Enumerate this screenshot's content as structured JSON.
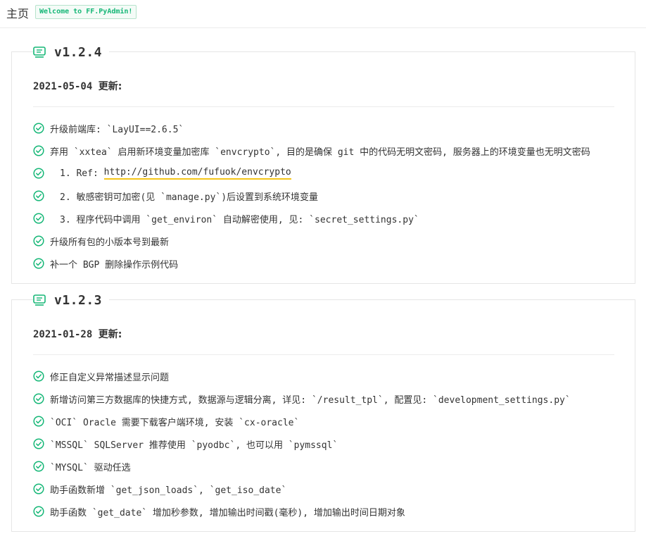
{
  "header": {
    "home_label": "主页",
    "welcome_text": "Welcome to FF.PyAdmin!"
  },
  "colors": {
    "accent": "#16b777",
    "link_underline": "#f5c518",
    "border": "#e6e6e6"
  },
  "icons": {
    "title": "note-icon",
    "bullet": "check-circle-icon"
  },
  "releases": [
    {
      "version": "v1.2.4",
      "date": "2021-05-04",
      "update_label": "更新:",
      "items": [
        {
          "text": "升级前端库: `LayUI==2.6.5`"
        },
        {
          "text": "弃用 `xxtea` 启用新环境变量加密库 `envcrypto`, 目的是确保 git 中的代码无明文密码, 服务器上的环境变量也无明文密码"
        },
        {
          "prefix": "1. Ref: ",
          "link": "http://github.com/fufuok/envcrypto"
        },
        {
          "text": "2. 敏感密钥可加密(见 `manage.py`)后设置到系统环境变量",
          "indent": true
        },
        {
          "text": "3. 程序代码中调用 `get_environ` 自动解密使用, 见: `secret_settings.py`",
          "indent": true
        },
        {
          "text": "升级所有包的小版本号到最新"
        },
        {
          "text": "补一个 BGP 删除操作示例代码"
        }
      ]
    },
    {
      "version": "v1.2.3",
      "date": "2021-01-28",
      "update_label": "更新:",
      "items": [
        {
          "text": "修正自定义异常描述显示问题"
        },
        {
          "text": "新增访问第三方数据库的快捷方式, 数据源与逻辑分离, 详见: `/result_tpl`, 配置见: `development_settings.py`"
        },
        {
          "text": "`OCI` Oracle 需要下载客户端环境, 安装 `cx-oracle`"
        },
        {
          "text": "`MSSQL` SQLServer 推荐使用 `pyodbc`, 也可以用 `pymssql`"
        },
        {
          "text": "`MYSQL` 驱动任选"
        },
        {
          "text": "助手函数新增 `get_json_loads`, `get_iso_date`"
        },
        {
          "text": "助手函数 `get_date` 增加秒参数, 增加输出时间戳(毫秒), 增加输出时间日期对象"
        }
      ]
    }
  ]
}
